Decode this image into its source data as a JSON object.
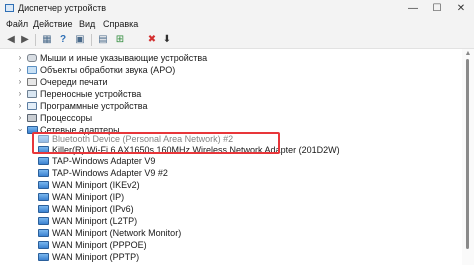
{
  "window": {
    "title": "Диспетчер устройств",
    "controls": {
      "minimize": "—",
      "maximize": "☐",
      "close": "✕"
    }
  },
  "menu": [
    "Файл",
    "Действие",
    "Вид",
    "Справка"
  ],
  "toolbar": {
    "back": "◀",
    "forward": "▶",
    "properties": "▦",
    "help": "?",
    "scan": "▣",
    "view": "▤",
    "add": "⊞",
    "uninstall": "✖",
    "update": "⬇"
  },
  "tree": {
    "categories": [
      {
        "label": "Мыши и иные указывающие устройства",
        "icon": "mouse-icon"
      },
      {
        "label": "Объекты обработки звука (APO)",
        "icon": "audio-icon"
      },
      {
        "label": "Очереди печати",
        "icon": "printer-queue-icon"
      },
      {
        "label": "Переносные устройства",
        "icon": "portable-device-icon"
      },
      {
        "label": "Программные устройства",
        "icon": "software-device-icon"
      },
      {
        "label": "Процессоры",
        "icon": "processor-icon"
      }
    ],
    "network_adapters": {
      "label": "Сетевые адаптеры",
      "children": [
        "Bluetooth Device (Personal Area Network) #2",
        "Killer(R) Wi-Fi 6 AX1650s 160MHz Wireless Network Adapter (201D2W)",
        "TAP-Windows Adapter V9",
        "TAP-Windows Adapter V9 #2",
        "WAN Miniport (IKEv2)",
        "WAN Miniport (IP)",
        "WAN Miniport (IPv6)",
        "WAN Miniport (L2TP)",
        "WAN Miniport (Network Monitor)",
        "WAN Miniport (PPPOE)",
        "WAN Miniport (PPTP)"
      ]
    }
  },
  "colors": {
    "highlight_border": "#e8363a",
    "chrome": "#f3f3f3"
  }
}
